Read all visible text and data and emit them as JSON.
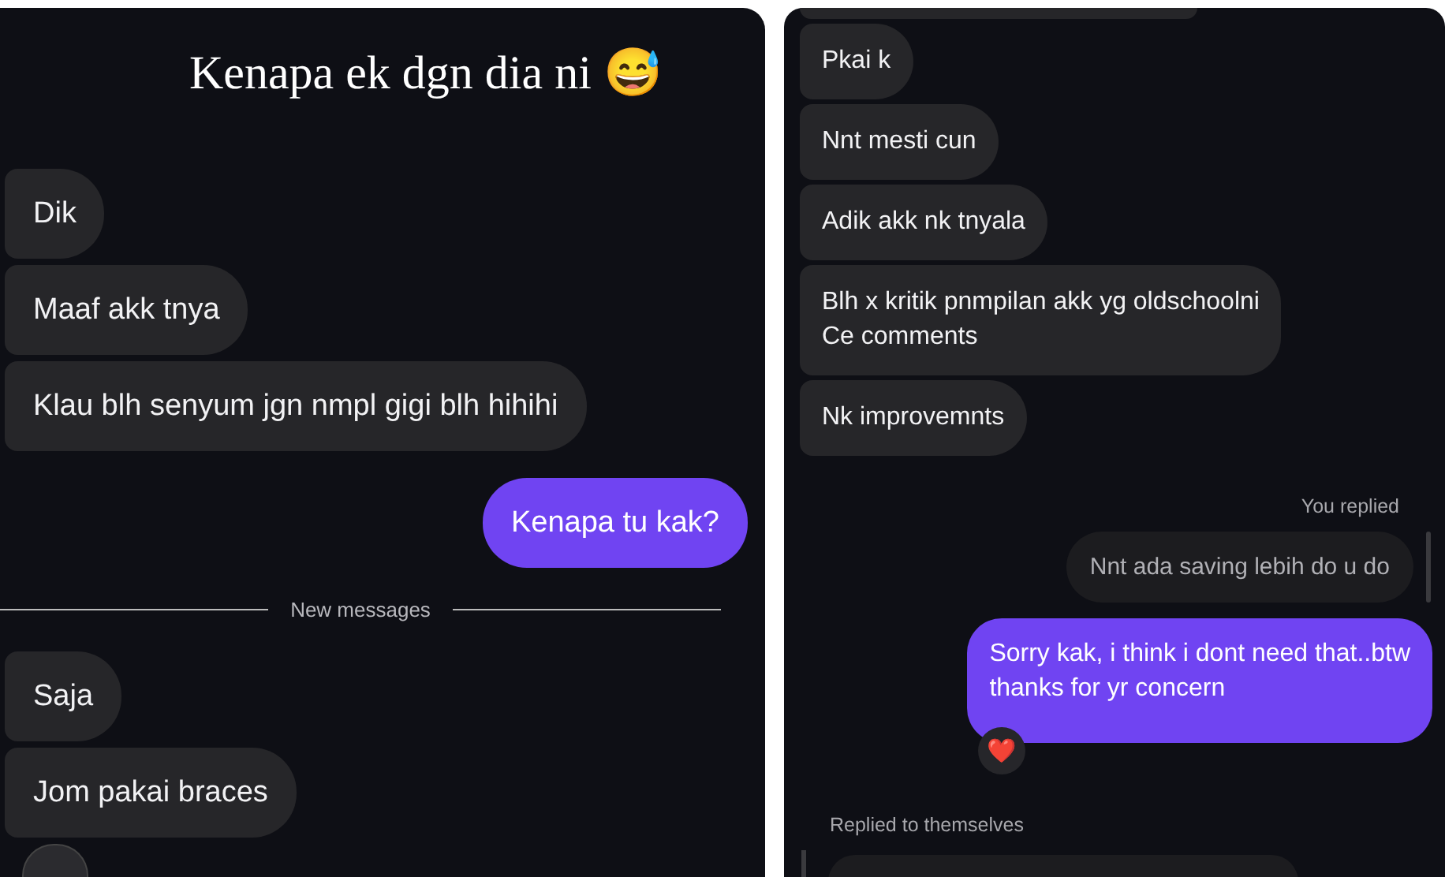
{
  "left_panel": {
    "caption": "Kenapa ek dgn dia ni 😅",
    "messages": [
      {
        "kind": "incoming",
        "text": "Dik"
      },
      {
        "kind": "incoming",
        "text": "Maaf akk tnya"
      },
      {
        "kind": "incoming",
        "text": "Klau blh senyum jgn nmpl gigi blh hihihi"
      },
      {
        "kind": "outgoing",
        "text": "Kenapa tu kak?"
      },
      {
        "kind": "divider",
        "text": "New messages"
      },
      {
        "kind": "incoming",
        "text": "Saja"
      },
      {
        "kind": "incoming",
        "text": "Jom pakai braces"
      },
      {
        "kind": "clipped"
      }
    ]
  },
  "right_panel": {
    "messages": [
      {
        "kind": "clipped"
      },
      {
        "kind": "incoming",
        "text": "Pkai k"
      },
      {
        "kind": "incoming",
        "text": "Nnt mesti cun"
      },
      {
        "kind": "incoming",
        "text": "Adik akk nk tnyala"
      },
      {
        "kind": "incoming",
        "text": "Blh x kritik pnmpilan akk yg oldschoolni\nCe comments"
      },
      {
        "kind": "incoming",
        "text": "Nk improvemnts"
      },
      {
        "kind": "reply_label",
        "text": "You replied"
      },
      {
        "kind": "quoted",
        "text": "Nnt ada saving lebih do u do"
      },
      {
        "kind": "outgoing",
        "text": "Sorry kak, i think i dont need that..btw\nthanks for yr concern",
        "reaction": "❤️"
      },
      {
        "kind": "reply_label_left",
        "text": "Replied to themselves"
      },
      {
        "kind": "clipped_quoted"
      }
    ]
  }
}
